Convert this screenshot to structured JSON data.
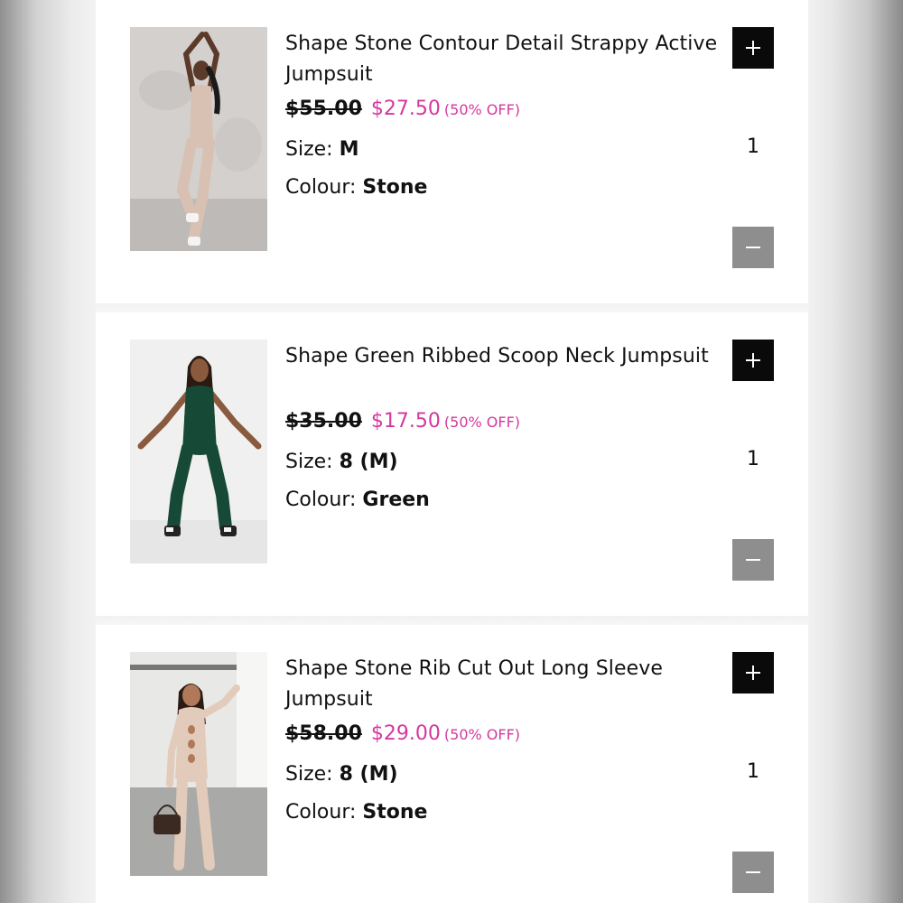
{
  "cart": {
    "items": [
      {
        "name": "Shape Stone Contour Detail Strappy Active Jumpsuit",
        "original_price": "$55.00",
        "sale_price": "$27.50",
        "discount": "(50% OFF)",
        "size_label": "Size:",
        "size_value": "M",
        "colour_label": "Colour:",
        "colour_value": "Stone",
        "quantity": "1"
      },
      {
        "name": " Shape Green Ribbed Scoop Neck Jumpsuit",
        "original_price": "$35.00",
        "sale_price": "$17.50",
        "discount": "(50% OFF)",
        "size_label": "Size:",
        "size_value": "8 (M)",
        "colour_label": "Colour:",
        "colour_value": "Green",
        "quantity": "1"
      },
      {
        "name": "Shape Stone Rib Cut Out Long Sleeve Jumpsuit",
        "original_price": "$58.00",
        "sale_price": "$29.00",
        "discount": "(50% OFF)",
        "size_label": "Size:",
        "size_value": "8 (M)",
        "colour_label": "Colour:",
        "colour_value": "Stone",
        "quantity": "1"
      }
    ],
    "icons": {
      "increase": "plus-icon",
      "decrease": "minus-icon"
    },
    "colors": {
      "sale_price": "#d4389e",
      "plus_button": "#0a0a0a",
      "minus_button": "#8e8e8e"
    }
  }
}
